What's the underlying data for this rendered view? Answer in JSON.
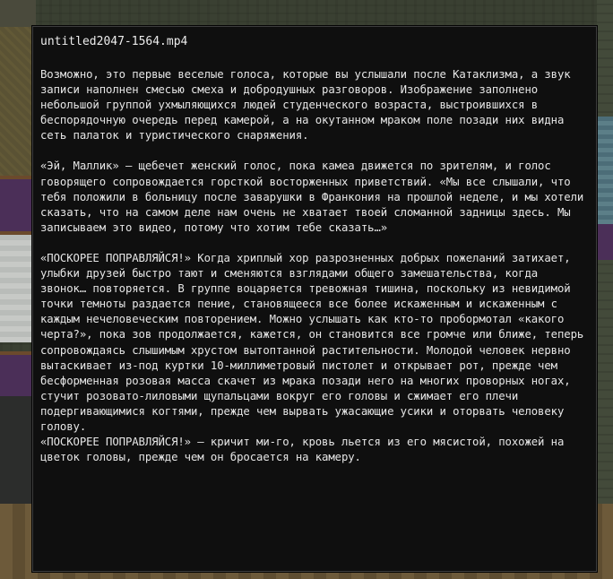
{
  "window": {
    "title": "untitled2047-1564.mp4"
  },
  "body": {
    "paragraphs": [
      "Возможно, это первые веселые голоса, которые вы услышали после Катаклизма, а звук записи наполнен смесью смеха и добродушных разговоров.  Изображение заполнено небольшой группой ухмыляющихся людей студенческого возраста, выстроившихся в беспорядочную очередь перед камерой, а на окутанном мраком поле позади них видна сеть палаток и туристического снаряжения.",
      "«Эй, Маллик» — щебечет женский голос, пока камеа движется по зрителям, и голос говорящего сопровождается горсткой восторженных приветствий.  «Мы все слышали, что тебя положили в больницу после заварушки в Франкония на прошлой неделе, и мы хотели сказать, что на самом деле нам очень не хватает твоей сломанной задницы здесь.  Мы записываем это видео, потому что хотим тебе сказать…»",
      "«ПОСКОРЕЕ ПОПРАВЛЯЙСЯ!»  Когда хриплый хор разрозненных добрых пожеланий затихает, улыбки друзей быстро тают и сменяются взглядами общего замешательства, когда звонок… повторяется.  В группе воцаряется тревожная тишина, поскольку из невидимой точки темноты раздается пение, становящееся все более искаженным и искаженным с каждым нечеловеческим повторением.  Можно услышать как кто-то пробормотал «какого черта?», пока зов продолжается, кажется, он становится все громче или ближе, теперь сопровождаясь слышимым хрустом вытоптанной растительности.  Молодой человек нервно вытаскивает из-под куртки 10-миллиметровый пистолет и открывает рот, прежде чем бесформенная розовая масса скачет из мрака позади него на многих проворных ногах, стучит розовато-лиловыми щупальцами вокруг его головы и сжимает его плечи подергивающимися когтями, прежде чем вырвать ужасающие усики и оторвать человеку голову.",
      "«ПОСКОРЕЕ ПОПРАВЛЯЙСЯ!» — кричит ми-го, кровь льется из его мясистой, похожей на цветок головы, прежде чем он бросается на камеру."
    ]
  }
}
